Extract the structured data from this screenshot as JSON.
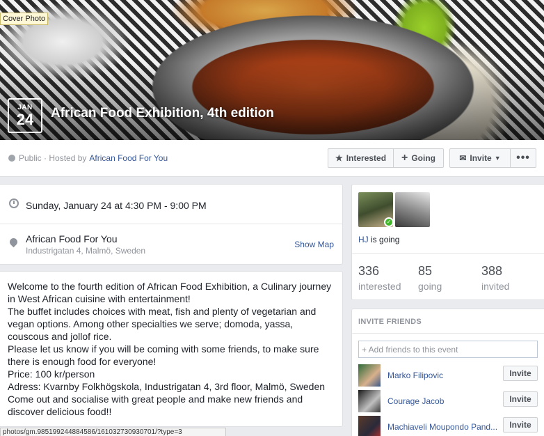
{
  "cover": {
    "label": "Cover Photo",
    "date_month": "JAN",
    "date_day": "24",
    "title": "African Food Exhibition, 4th edition"
  },
  "action_bar": {
    "privacy": "Public · Hosted by",
    "host": "African Food For You",
    "interested_label": "Interested",
    "going_label": "Going",
    "invite_label": "Invite",
    "more_label": "•••",
    "icons": {
      "privacy": "globe-icon",
      "interested": "star-icon",
      "going": "plus-icon",
      "invite": "envelope-icon",
      "invite_caret": "chevron-down-icon"
    }
  },
  "details": {
    "time": "Sunday, January 24 at 4:30 PM - 9:00 PM",
    "location_name": "African Food For You",
    "location_address": "Industrigatan 4, Malmö, Sweden",
    "show_map": "Show Map",
    "icons": {
      "time": "clock-icon",
      "location": "map-pin-icon"
    }
  },
  "description": "Welcome to the fourth edition of African Food Exhibition, a Culinary journey in West African cuisine with entertainment!\nThe buffet includes choices with meat, fish and plenty of vegetarian and vegan options. Among other specialties we serve; domoda, yassa, couscous and jollof rice.\nPlease let us know if you will be coming with some friends, to make sure there is enough food for everyone!\nPrice: 100 kr/person\nAdress: Kvarnby Folkhögskola, Industrigatan 4, 3rd floor, Malmö, Sweden\nCome out and socialise with great people and make new friends and discover delicious food!!",
  "guests": {
    "going_name": "HJ",
    "going_suffix": "is going",
    "stats": [
      {
        "num": "336",
        "label": "interested"
      },
      {
        "num": "85",
        "label": "going"
      },
      {
        "num": "388",
        "label": "invited"
      }
    ]
  },
  "invite_friends": {
    "heading": "INVITE FRIENDS",
    "placeholder": "+ Add friends to this event",
    "friends": [
      {
        "name": "Marko Filipovic",
        "button": "Invite"
      },
      {
        "name": "Courage Jacob",
        "button": "Invite"
      },
      {
        "name": "Machiaveli Moupondo Pand...",
        "button": "Invite"
      }
    ]
  },
  "status_bar_url": "photos/gm.985199244884586/161032730930701/?type=3"
}
